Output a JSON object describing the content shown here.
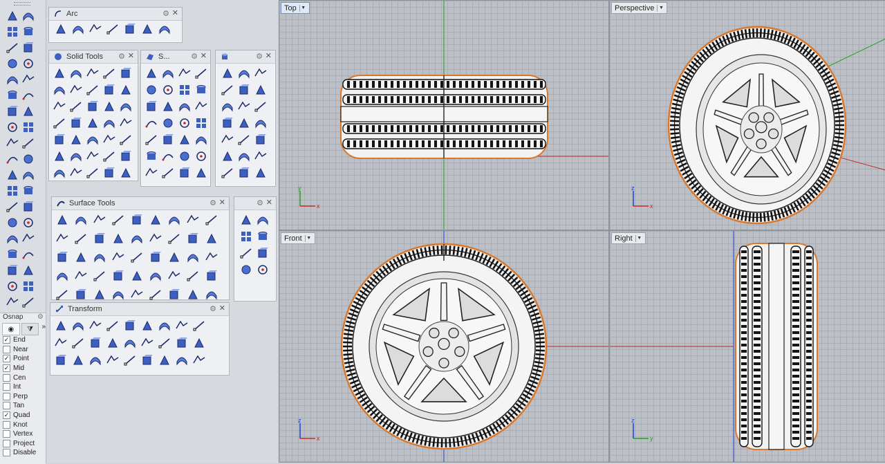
{
  "palettes": {
    "arc": {
      "title": "Arc"
    },
    "solid_tools": {
      "title": "Solid Tools"
    },
    "surface_short": {
      "title": "S..."
    },
    "surface_tools": {
      "title": "Surface Tools"
    },
    "transform": {
      "title": "Transform"
    }
  },
  "osnap": {
    "title": "Osnap",
    "items": [
      {
        "label": "End",
        "checked": "✓"
      },
      {
        "label": "Near",
        "checked": ""
      },
      {
        "label": "Point",
        "checked": "✓"
      },
      {
        "label": "Mid",
        "checked": "✓"
      },
      {
        "label": "Cen",
        "checked": ""
      },
      {
        "label": "Int",
        "checked": ""
      },
      {
        "label": "Perp",
        "checked": ""
      },
      {
        "label": "Tan",
        "checked": ""
      },
      {
        "label": "Quad",
        "checked": "✓"
      },
      {
        "label": "Knot",
        "checked": ""
      },
      {
        "label": "Vertex",
        "checked": ""
      },
      {
        "label": "Project",
        "checked": ""
      },
      {
        "label": "Disable",
        "checked": ""
      }
    ]
  },
  "viewports": {
    "top": {
      "label": "Top"
    },
    "perspective": {
      "label": "Perspective"
    },
    "front": {
      "label": "Front"
    },
    "right": {
      "label": "Right"
    }
  },
  "axis_labels": {
    "x": "x",
    "y": "y",
    "z": "z"
  },
  "colors": {
    "accent": "#2f62c9",
    "x_axis": "#c62828",
    "y_axis": "#1fa31f",
    "z_axis": "#1f3fd8",
    "tire_edge": "#d9772b",
    "grid": "#a9adb4",
    "viewport_bg": "#bcc0c6"
  }
}
